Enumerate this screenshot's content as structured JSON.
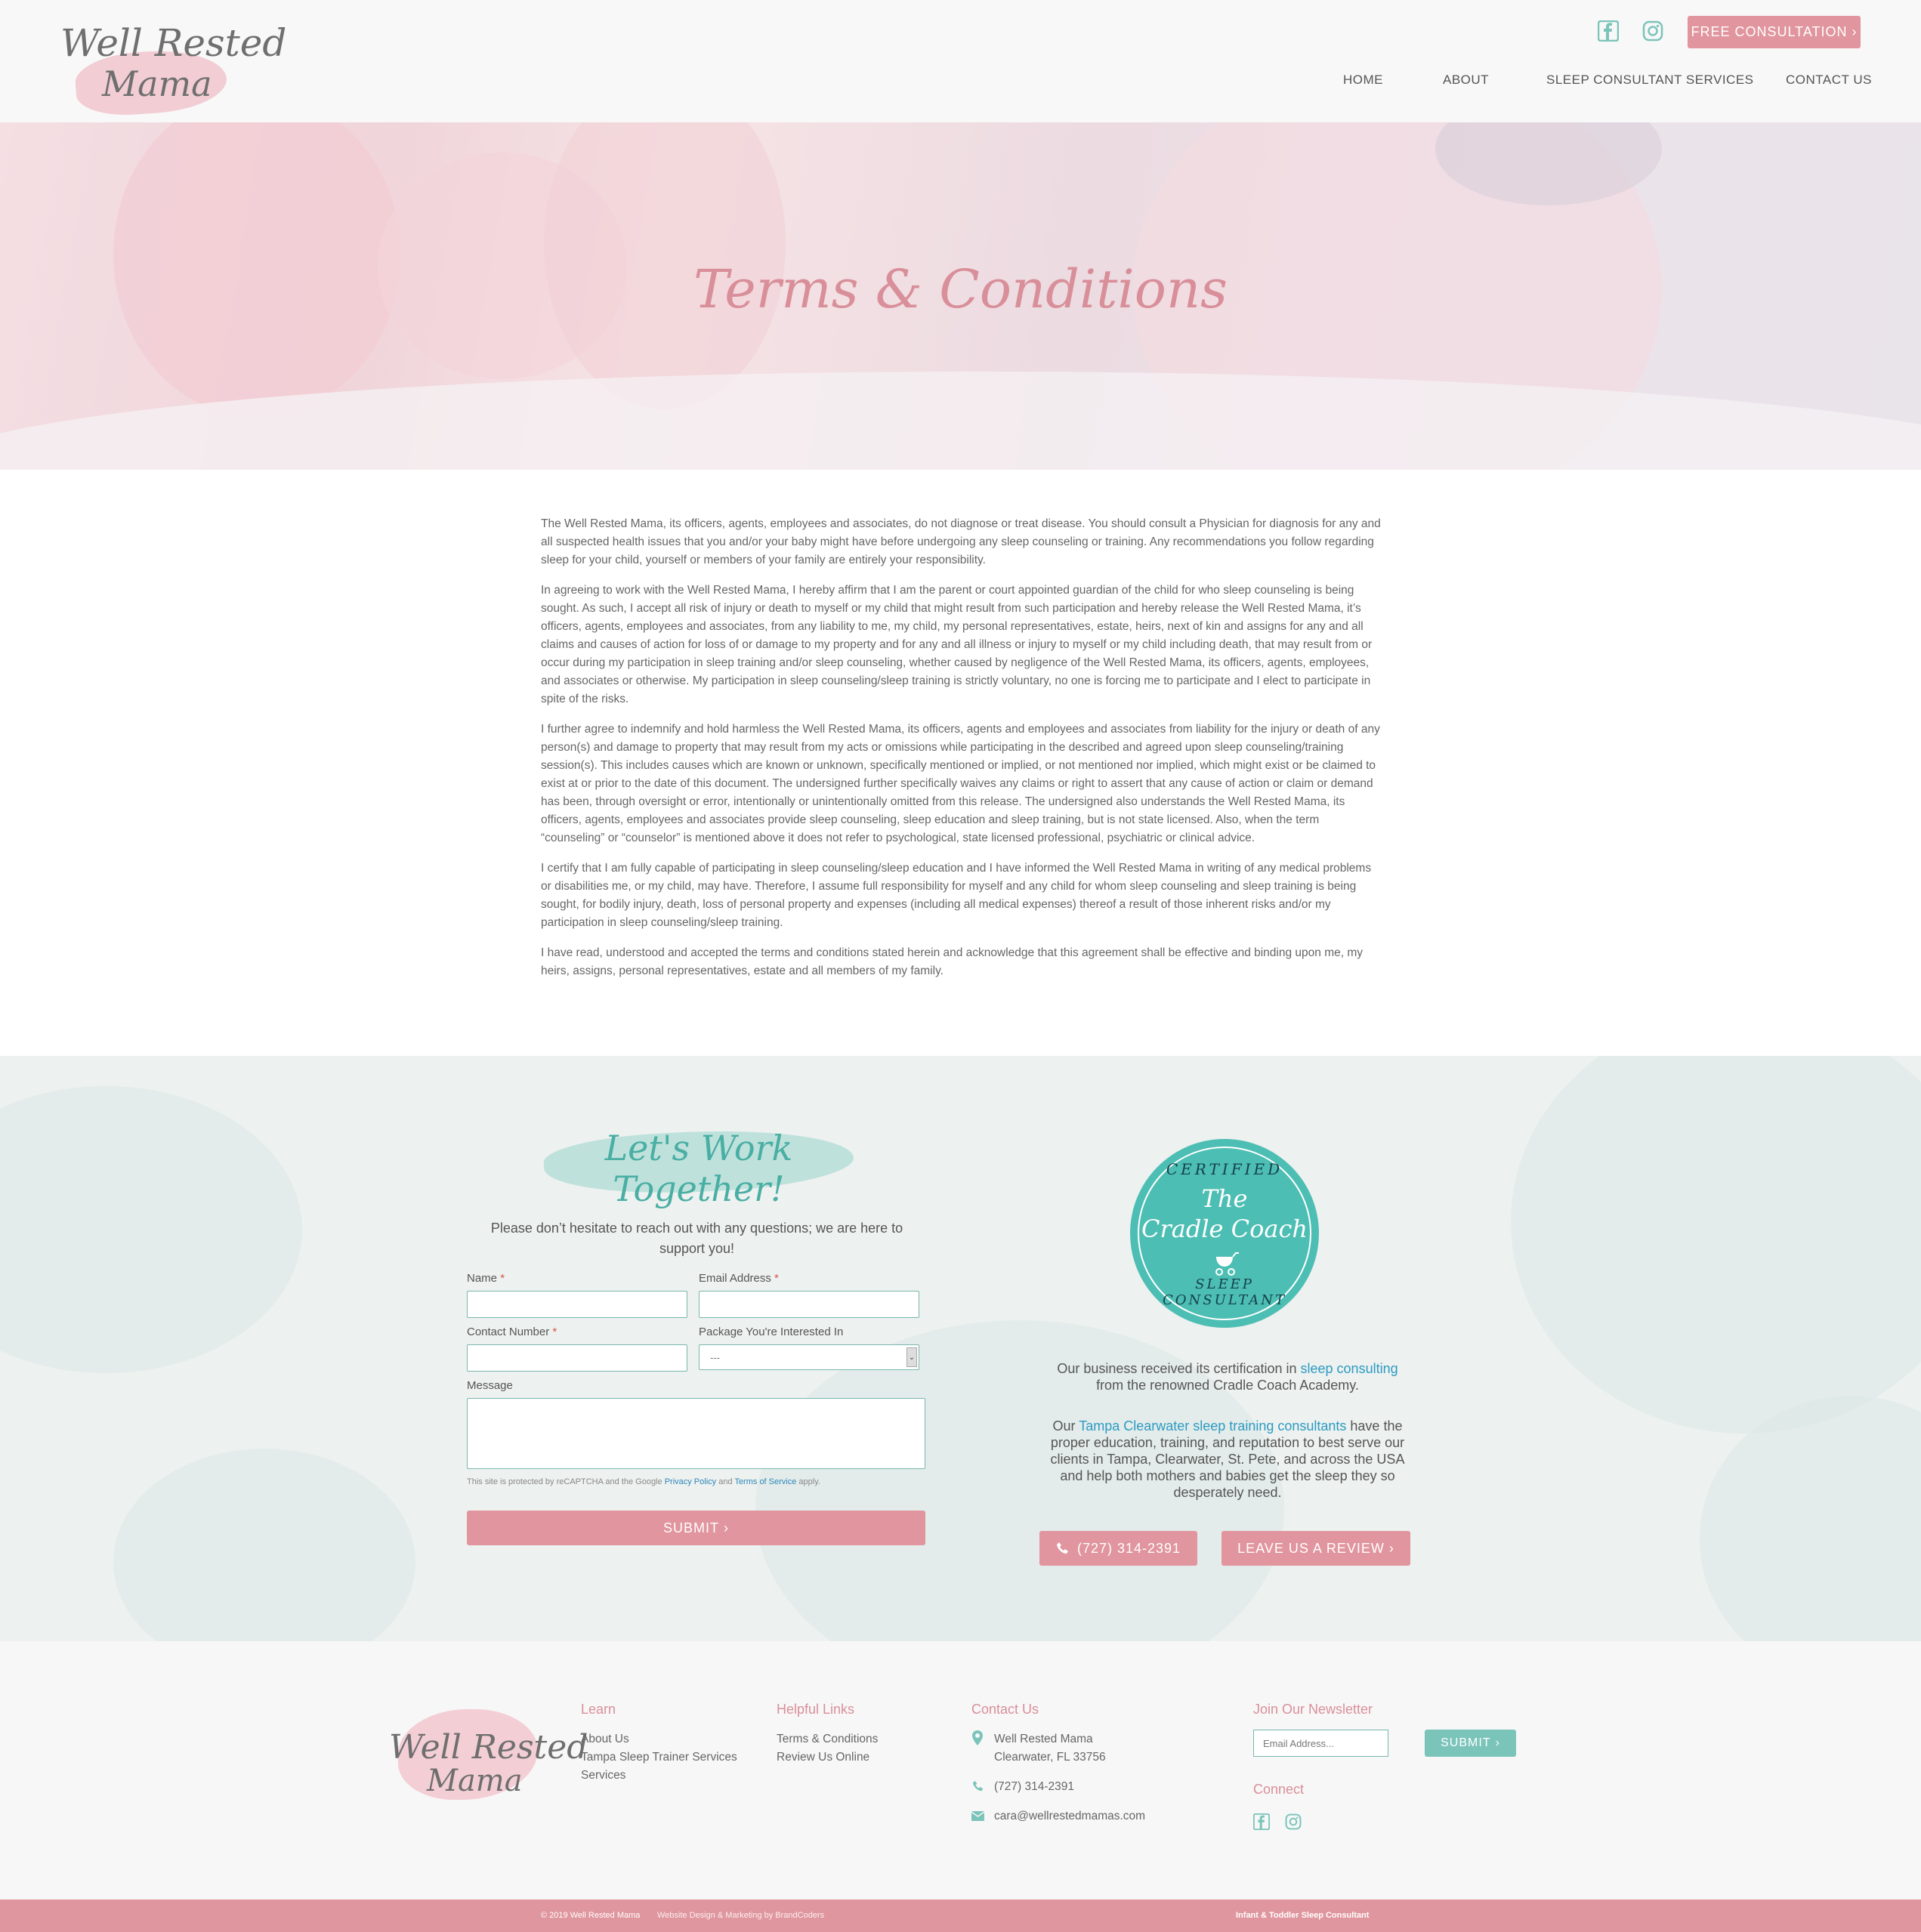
{
  "header": {
    "logo_line1": "Well Rested",
    "logo_line2": "Mama",
    "cta": "FREE CONSULTATION",
    "nav": [
      "HOME",
      "ABOUT",
      "SLEEP CONSULTANT SERVICES",
      "CONTACT US"
    ]
  },
  "hero": {
    "title": "Terms & Conditions"
  },
  "terms": {
    "paragraphs": [
      "The Well Rested Mama, its officers, agents, employees and associates, do not diagnose or treat disease. You should consult a Physician for diagnosis for any and all suspected health issues that you and/or your baby might have before undergoing any sleep counseling or training. Any recommendations you follow regarding sleep for your child, yourself or members of your family are entirely your responsibility.",
      "In agreeing to work with the Well Rested Mama, I hereby affirm that I am the parent or court appointed guardian of the child for who sleep counseling is being sought. As such, I accept all risk of injury or death to myself or my child that might result from such participation and hereby release the Well Rested Mama, it’s officers, agents, employees and associates, from any liability to me, my child, my personal representatives, estate, heirs, next of kin and assigns for any and all claims and causes of action for loss of or damage to my property and for any and all illness or injury to myself or my child including death, that may result from or occur during my participation in sleep training and/or sleep counseling, whether caused by negligence of the Well Rested Mama, its officers, agents, employees, and associates or otherwise. My participation in sleep counseling/sleep training is strictly voluntary, no one is forcing me to participate and I elect to participate in spite of the risks.",
      "I further agree to indemnify and hold harmless the Well Rested Mama, its officers, agents and employees and associates from liability for the injury or death of any person(s) and damage to property that may result from my acts or omissions while participating in the described and agreed upon sleep counseling/training session(s). This includes causes which are known or unknown, specifically mentioned or implied, or not mentioned nor implied, which might exist or be claimed to exist at or prior to the date of this document. The undersigned further specifically waives any claims or right to assert that any cause of action or claim or demand has been, through oversight or error, intentionally or unintentionally omitted from this release. The undersigned also understands the Well Rested Mama, its officers, agents, employees and associates provide sleep counseling, sleep education and sleep training, but is not state licensed. Also, when the term “counseling” or “counselor” is mentioned above it does not refer to psychological, state licensed professional, psychiatric or clinical advice.",
      "I certify that I am fully capable of participating in sleep counseling/sleep education and I have informed the Well Rested Mama in writing of any medical problems or disabilities me, or my child, may have. Therefore, I assume full responsibility for myself and any child for whom sleep counseling and sleep training is being sought, for bodily injury, death, loss of personal property and expenses (including all medical expenses) thereof a result of those inherent risks and/or my participation in sleep counseling/sleep training.",
      "I have read, understood and accepted the terms and conditions stated herein and acknowledge that this agreement shall be effective and binding upon me, my heirs, assigns, personal representatives, estate and all members of my family."
    ]
  },
  "contact": {
    "heading": "Let's Work Together!",
    "intro": "Please don’t hesitate to reach out with any questions; we are here to support you!",
    "form": {
      "name_label": "Name",
      "email_label": "Email Address",
      "phone_label": "Contact Number",
      "package_label": "Package You're Interested In",
      "package_value": "---",
      "message_label": "Message",
      "required_mark": "*",
      "recaptcha_pre": "This site is protected by reCAPTCHA and the Google ",
      "privacy": "Privacy Policy",
      "and": " and ",
      "terms": "Terms of Service",
      "recaptcha_post": " apply.",
      "submit": "SUBMIT"
    },
    "badge": {
      "top": "CERTIFIED",
      "the": "The",
      "name": "Cradle Coach",
      "bottom": "SLEEP CONSULTANT"
    },
    "cert_pre": "Our business received its certification in ",
    "cert_link": "sleep consulting",
    "cert_post": "from the renowned Cradle Coach Academy.",
    "tampa_pre": "Our ",
    "tampa_link": "Tampa Clearwater sleep training consultants",
    "tampa_post": " have the proper education, training, and reputation to best serve our clients in Tampa, Clearwater, St. Pete, and across the USA and help both mothers and babies get the sleep they so desperately need.",
    "phone_btn": "(727) 314-2391",
    "review_btn": "LEAVE US A REVIEW"
  },
  "footer": {
    "learn_head": "Learn",
    "learn_links": [
      "About Us",
      "Tampa Sleep Trainer Services",
      "Services"
    ],
    "helpful_head": "Helpful Links",
    "helpful_links": [
      "Terms & Conditions",
      "Review Us Online"
    ],
    "contact_head": "Contact Us",
    "address1": "Well Rested Mama",
    "address2": "Clearwater, FL 33756",
    "phone": "(727) 314-2391",
    "email": "cara@wellrestedmamas.com",
    "newsletter_head": "Join Our Newsletter",
    "newsletter_placeholder": "Email Address...",
    "newsletter_submit": "SUBMIT",
    "connect_head": "Connect"
  },
  "bottom": {
    "copyright": "© 2019 Well Rested Mama",
    "credit": "Website Design & Marketing by BrandCoders",
    "tagline": "Infant & Toddler Sleep Consultant"
  },
  "colors": {
    "pink": "#e1959e",
    "teal": "#4dbeb3",
    "link": "#2d9bc2"
  }
}
